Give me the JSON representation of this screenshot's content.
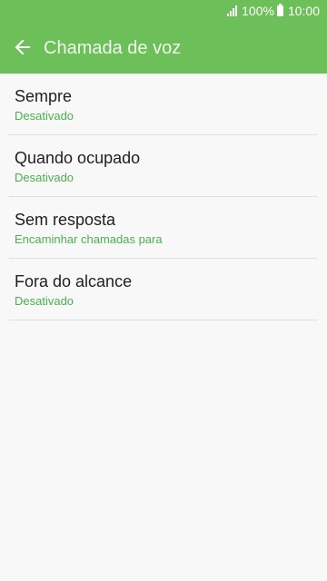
{
  "status_bar": {
    "battery": "100%",
    "time": "10:00"
  },
  "header": {
    "title": "Chamada de voz",
    "back_icon": "arrow-left-icon"
  },
  "items": [
    {
      "title": "Sempre",
      "subtitle": "Desativado"
    },
    {
      "title": "Quando ocupado",
      "subtitle": "Desativado"
    },
    {
      "title": "Sem resposta",
      "subtitle": "Encaminhar chamadas para"
    },
    {
      "title": "Fora do alcance",
      "subtitle": "Desativado"
    }
  ],
  "colors": {
    "header_bg": "#6cbf59",
    "accent_text": "#4caf50",
    "background": "#f8f8f8"
  }
}
